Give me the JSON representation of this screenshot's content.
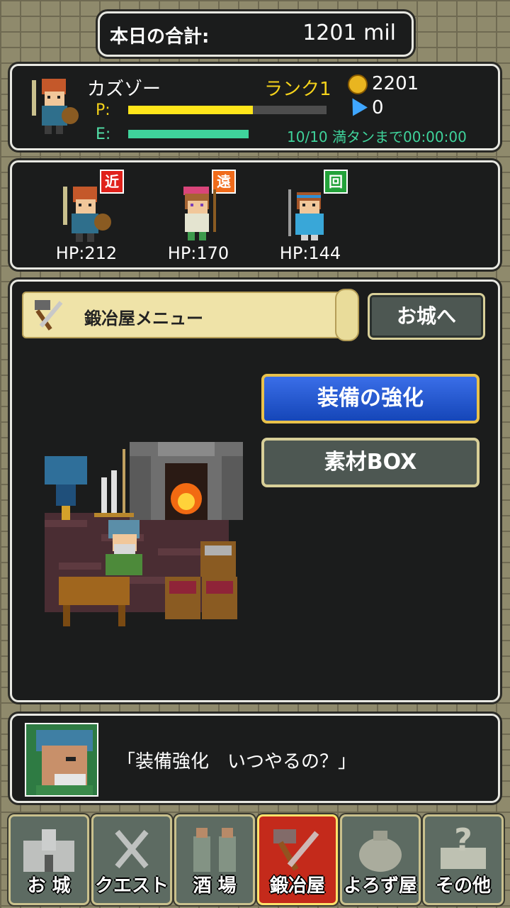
{
  "header": {
    "total_label": "本日の合計:",
    "total_value": "1201 mil"
  },
  "status": {
    "name": "カズゾー",
    "rank": "ランク1",
    "gold": "2201",
    "gems": "0",
    "p_label": "P:",
    "e_label": "E:",
    "p_fill": 0.63,
    "e_fill": 1.0,
    "energy_text": "10/10 満タンまで00:00:00"
  },
  "party": [
    {
      "role": "近",
      "role_color": "#e0211b",
      "hp": "HP:212"
    },
    {
      "role": "遠",
      "role_color": "#f06b1b",
      "hp": "HP:170"
    },
    {
      "role": "回",
      "role_color": "#23a23a",
      "hp": "HP:144"
    }
  ],
  "main": {
    "title": "鍛冶屋メニュー",
    "castle_button": "お城へ",
    "upgrade_button": "装備の強化",
    "material_button": "素材BOX"
  },
  "dialog": {
    "text": "「装備強化　いつやるの？」"
  },
  "nav": [
    {
      "label": "お 城",
      "icon": "castle-icon"
    },
    {
      "label": "クエスト",
      "icon": "swords-icon"
    },
    {
      "label": "酒 場",
      "icon": "tavern-icon"
    },
    {
      "label": "鍛冶屋",
      "icon": "hammer-icon",
      "active": true
    },
    {
      "label": "よろず屋",
      "icon": "bag-icon"
    },
    {
      "label": "その他",
      "icon": "question-icon"
    }
  ]
}
